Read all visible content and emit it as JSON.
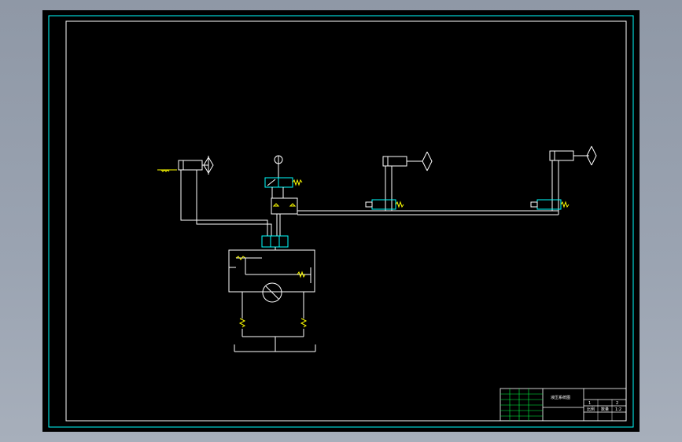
{
  "title_block": {
    "title": "液压系统图",
    "cells": [
      "1",
      "2",
      "比例",
      "数量",
      "1:2"
    ]
  },
  "colors": {
    "background_outer": "#9ba4b2",
    "canvas": "#000000",
    "frame": "#00ffff",
    "lines": "#ffffff",
    "valve_body": "#00ffff",
    "spring": "#ffff00"
  }
}
